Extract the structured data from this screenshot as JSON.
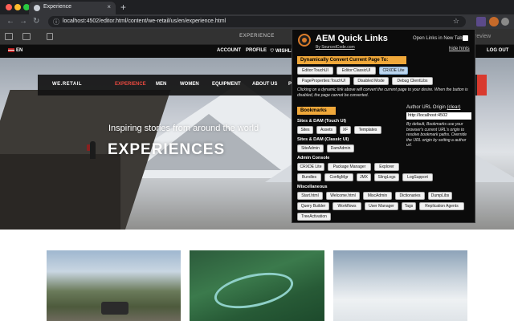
{
  "browser": {
    "tab_title": "Experience",
    "tab_close": "×",
    "new_tab": "+",
    "url": "localhost:4502/editor.html/content/we-retail/us/en/experience.html",
    "back": "←",
    "forward": "→",
    "reload": "↻",
    "lock": "ⓘ",
    "star": "☆"
  },
  "aem_editor": {
    "page_title": "EXPERIENCE",
    "preview_label": "review"
  },
  "site": {
    "lang": "EN",
    "top_links": [
      "ACCOUNT",
      "PROFILE",
      "♡ WISHLI",
      "LOG OUT"
    ],
    "brand": "WE.RETAIL",
    "nav": [
      "EXPERIENCE",
      "MEN",
      "WOMEN",
      "EQUIPMENT",
      "ABOUT US",
      "P"
    ],
    "hero_tagline": "Inspiring stories from around the world",
    "hero_title": "EXPERIENCES"
  },
  "popup": {
    "title": "AEM Quick Links",
    "byline": "By SourcedCode.com",
    "open_new_tab": "Open Links in New Tab",
    "hide_hints": "hide hints",
    "convert_heading": "Dynamically Convert Current Page To:",
    "convert_buttons": [
      "Editor:TouchUI",
      "Editor:ClassicUI",
      "CRXDE Lite",
      "PageProperties:TouchUI",
      "Disabled Mode",
      "Debug ClientLibs"
    ],
    "convert_hint": "Clicking on a dynamic link above will convert the current page to your desire. When the button is disabled, the page cannot be converted.",
    "bookmarks_heading": "Bookmarks",
    "author_origin_label": "Author URL Origin",
    "author_origin_clear": "(clear)",
    "author_origin_value": "http://localhost:4502",
    "origin_hint": "By default, Bookmarks use your browser's current URL's origin to resolve bookmark paths. Override the URL origin by setting a author url.",
    "sections": [
      {
        "title": "Sites & DAM (Touch UI)",
        "buttons": [
          "Sites",
          "Assets",
          "XF",
          "Templates"
        ]
      },
      {
        "title": "Sites & DAM (Classic UI)",
        "buttons": [
          "SiteAdmin",
          "DamAdmin"
        ]
      },
      {
        "title": "Admin Console",
        "buttons": [
          "CRXDE Lite",
          "Package Manager",
          "Explorer",
          "Bundles",
          "ConfigMgr",
          "JMX",
          "SlingLogs",
          "LogSupport"
        ]
      },
      {
        "title": "Miscellaneous",
        "buttons": [
          "Start.html",
          "Welcome.html",
          "MiscAdmin",
          "Dictionaries",
          "DumpLibs",
          "Query Builder",
          "Workflows",
          "User Manager",
          "Tags",
          "Replication Agents",
          "TreeActivation"
        ]
      }
    ]
  },
  "colors": {
    "accent_orange": "#f0a83a",
    "active_nav_red": "#e8493f",
    "dark": "#0b0b0b"
  }
}
